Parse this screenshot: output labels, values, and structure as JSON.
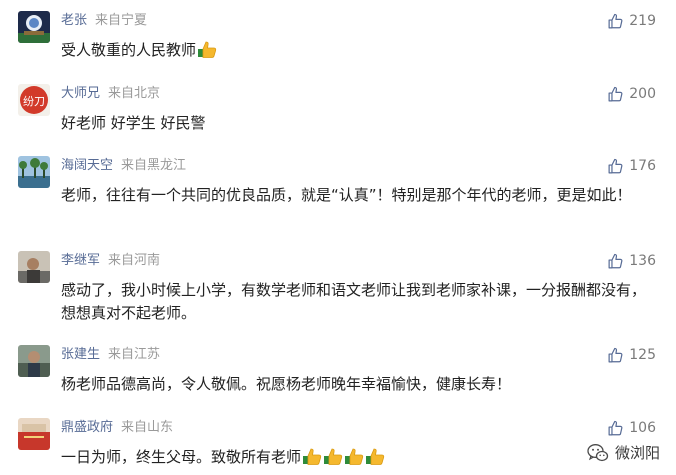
{
  "comments": [
    {
      "name": "老张",
      "location": "来自宁夏",
      "likes": "219",
      "text": "受人敬重的人民教师",
      "thumbs": 1
    },
    {
      "name": "大师兄",
      "location": "来自北京",
      "likes": "200",
      "text": "好老师 好学生 好民警",
      "thumbs": 0
    },
    {
      "name": "海阔天空",
      "location": "来自黑龙江",
      "likes": "176",
      "text": "老师，往往有一个共同的优良品质，就是“认真”！特别是那个年代的老师，更是如此！",
      "thumbs": 0
    },
    {
      "name": "李继军",
      "location": "来自河南",
      "likes": "136",
      "text": "感动了，我小时候上小学，有数学老师和语文老师让我到老师家补课，一分报酬都没有，想想真对不起老师。",
      "thumbs": 0
    },
    {
      "name": "张建生",
      "location": "来自江苏",
      "likes": "125",
      "text": "杨老师品德高尚，令人敬佩。祝愿杨老师晚年幸福愉快，健康长寿！",
      "thumbs": 0
    },
    {
      "name": "鼎盛政府",
      "location": "来自山东",
      "likes": "106",
      "text": "一日为师，终生父母。致敬所有老师",
      "thumbs": 4
    }
  ],
  "avatar2_text": "纷刀",
  "watermark": "微浏阳",
  "icons": {
    "like": "thumb-up-icon",
    "emoji": "thumbs-up-emoji",
    "watermark": "wechat-icon"
  }
}
